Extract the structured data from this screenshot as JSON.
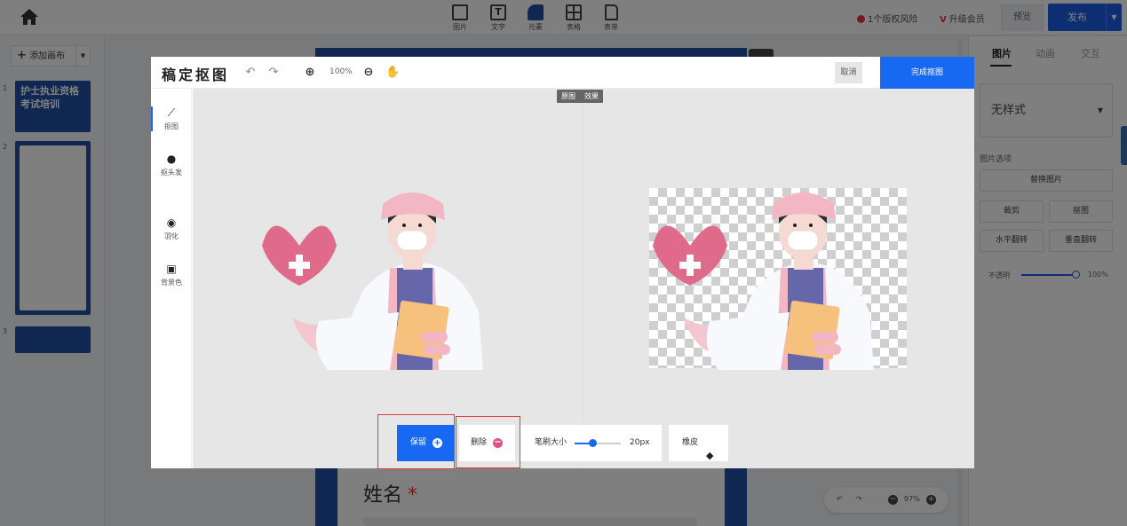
{
  "topbar": {
    "tools": [
      {
        "label": "图片",
        "icon": "image-icon"
      },
      {
        "label": "文字",
        "icon": "text-icon"
      },
      {
        "label": "元素",
        "icon": "shapes-icon"
      },
      {
        "label": "表格",
        "icon": "table-icon"
      },
      {
        "label": "表单",
        "icon": "form-icon"
      }
    ],
    "risk": "1个版权风险",
    "upgrade": "升级会员",
    "preview": "预览",
    "publish": "发布"
  },
  "left_panel": {
    "add_page": "添加画布",
    "pages": [
      "1",
      "2",
      "3"
    ],
    "thumb1_title": "护士执业资格考试培训"
  },
  "canvas": {
    "field_label": "姓名",
    "required_mark": "*",
    "zoom": "97%"
  },
  "right_panel": {
    "tabs": [
      "图片",
      "动画",
      "交互"
    ],
    "style_select": "无样式",
    "options_title": "图片选项",
    "replace": "替换图片",
    "crop": "裁剪",
    "cutout": "抠图",
    "flip_h": "水平翻转",
    "flip_v": "垂直翻转",
    "opacity_label": "不透明",
    "opacity_value": "100%",
    "opacity": 1.0
  },
  "modal": {
    "title": "稿定抠图",
    "zoom": "100%",
    "cancel": "取消",
    "done": "完成抠图",
    "side_tools": [
      "抠图",
      "抠头发",
      "羽化",
      "背景色"
    ],
    "view_toggle": [
      "原图",
      "效果"
    ],
    "toolbar": {
      "keep": "保留",
      "remove": "删除",
      "brush_label": "笔刷大小",
      "brush_value": "20px",
      "eraser": "橡皮"
    }
  },
  "colors": {
    "accent": "#1768f2",
    "brand_blue": "#1e4fa3",
    "remove_pink": "#e2508a",
    "highlight_red": "#e53935"
  }
}
